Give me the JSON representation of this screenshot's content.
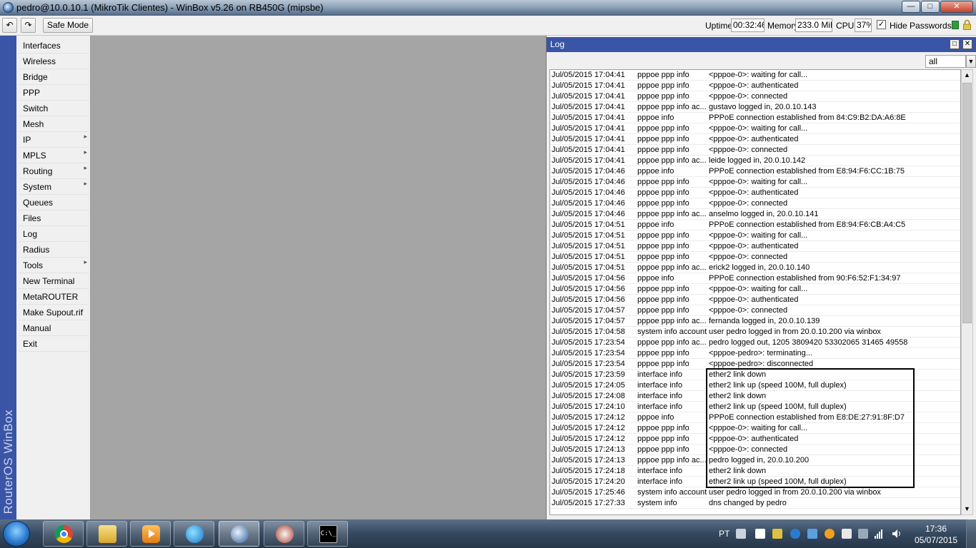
{
  "window": {
    "title": "pedro@10.0.10.1 (MikroTik Clientes) - WinBox v5.26 on RB450G (mipsbe)",
    "minimize_icon": "minimize-icon",
    "maximize_icon": "maximize-icon",
    "close_icon": "close-icon"
  },
  "toolbar": {
    "undo_icon": "undo-icon",
    "redo_icon": "redo-icon",
    "safe_mode_label": "Safe Mode",
    "uptime_label": "Uptime:",
    "uptime_value": "00:32:46",
    "memory_label": "Memory:",
    "memory_value": "233.0 MiB",
    "cpu_label": "CPU:",
    "cpu_value": "37%",
    "hide_passwords_checked": true,
    "hide_passwords_label": "Hide Passwords"
  },
  "sidebar": {
    "brand": "RouterOS WinBox",
    "items": [
      {
        "label": "Interfaces",
        "submenu": false
      },
      {
        "label": "Wireless",
        "submenu": false
      },
      {
        "label": "Bridge",
        "submenu": false
      },
      {
        "label": "PPP",
        "submenu": false
      },
      {
        "label": "Switch",
        "submenu": false
      },
      {
        "label": "Mesh",
        "submenu": false
      },
      {
        "label": "IP",
        "submenu": true
      },
      {
        "label": "MPLS",
        "submenu": true
      },
      {
        "label": "Routing",
        "submenu": true
      },
      {
        "label": "System",
        "submenu": true
      },
      {
        "label": "Queues",
        "submenu": false
      },
      {
        "label": "Files",
        "submenu": false
      },
      {
        "label": "Log",
        "submenu": false
      },
      {
        "label": "Radius",
        "submenu": false
      },
      {
        "label": "Tools",
        "submenu": true
      },
      {
        "label": "New Terminal",
        "submenu": false
      },
      {
        "label": "MetaROUTER",
        "submenu": false
      },
      {
        "label": "Make Supout.rif",
        "submenu": false
      },
      {
        "label": "Manual",
        "submenu": false
      },
      {
        "label": "Exit",
        "submenu": false
      }
    ]
  },
  "log": {
    "title": "Log",
    "filter_value": "all",
    "highlighted_rows": {
      "from": 28,
      "to": 38
    },
    "rows": [
      {
        "time": "Jul/05/2015 17:04:41",
        "topics": "pppoe ppp info",
        "message": "<pppoe-0>: waiting for call..."
      },
      {
        "time": "Jul/05/2015 17:04:41",
        "topics": "pppoe ppp info",
        "message": "<pppoe-0>: authenticated"
      },
      {
        "time": "Jul/05/2015 17:04:41",
        "topics": "pppoe ppp info",
        "message": "<pppoe-0>: connected"
      },
      {
        "time": "Jul/05/2015 17:04:41",
        "topics": "pppoe ppp info ac...",
        "message": "gustavo logged in, 20.0.10.143"
      },
      {
        "time": "Jul/05/2015 17:04:41",
        "topics": "pppoe info",
        "message": "PPPoE connection established from 84:C9:B2:DA:A6:8E"
      },
      {
        "time": "Jul/05/2015 17:04:41",
        "topics": "pppoe ppp info",
        "message": "<pppoe-0>: waiting for call..."
      },
      {
        "time": "Jul/05/2015 17:04:41",
        "topics": "pppoe ppp info",
        "message": "<pppoe-0>: authenticated"
      },
      {
        "time": "Jul/05/2015 17:04:41",
        "topics": "pppoe ppp info",
        "message": "<pppoe-0>: connected"
      },
      {
        "time": "Jul/05/2015 17:04:41",
        "topics": "pppoe ppp info ac...",
        "message": "leide logged in, 20.0.10.142"
      },
      {
        "time": "Jul/05/2015 17:04:46",
        "topics": "pppoe info",
        "message": "PPPoE connection established from E8:94:F6:CC:1B:75"
      },
      {
        "time": "Jul/05/2015 17:04:46",
        "topics": "pppoe ppp info",
        "message": "<pppoe-0>: waiting for call..."
      },
      {
        "time": "Jul/05/2015 17:04:46",
        "topics": "pppoe ppp info",
        "message": "<pppoe-0>: authenticated"
      },
      {
        "time": "Jul/05/2015 17:04:46",
        "topics": "pppoe ppp info",
        "message": "<pppoe-0>: connected"
      },
      {
        "time": "Jul/05/2015 17:04:46",
        "topics": "pppoe ppp info ac...",
        "message": "anselmo logged in, 20.0.10.141"
      },
      {
        "time": "Jul/05/2015 17:04:51",
        "topics": "pppoe info",
        "message": "PPPoE connection established from E8:94:F6:CB:A4:C5"
      },
      {
        "time": "Jul/05/2015 17:04:51",
        "topics": "pppoe ppp info",
        "message": "<pppoe-0>: waiting for call..."
      },
      {
        "time": "Jul/05/2015 17:04:51",
        "topics": "pppoe ppp info",
        "message": "<pppoe-0>: authenticated"
      },
      {
        "time": "Jul/05/2015 17:04:51",
        "topics": "pppoe ppp info",
        "message": "<pppoe-0>: connected"
      },
      {
        "time": "Jul/05/2015 17:04:51",
        "topics": "pppoe ppp info ac...",
        "message": "erick2 logged in, 20.0.10.140"
      },
      {
        "time": "Jul/05/2015 17:04:56",
        "topics": "pppoe info",
        "message": "PPPoE connection established from 90:F6:52:F1:34:97"
      },
      {
        "time": "Jul/05/2015 17:04:56",
        "topics": "pppoe ppp info",
        "message": "<pppoe-0>: waiting for call..."
      },
      {
        "time": "Jul/05/2015 17:04:56",
        "topics": "pppoe ppp info",
        "message": "<pppoe-0>: authenticated"
      },
      {
        "time": "Jul/05/2015 17:04:57",
        "topics": "pppoe ppp info",
        "message": "<pppoe-0>: connected"
      },
      {
        "time": "Jul/05/2015 17:04:57",
        "topics": "pppoe ppp info ac...",
        "message": "fernanda logged in, 20.0.10.139"
      },
      {
        "time": "Jul/05/2015 17:04:58",
        "topics": "system info account",
        "message": "user pedro logged in from 20.0.10.200 via winbox"
      },
      {
        "time": "Jul/05/2015 17:23:54",
        "topics": "pppoe ppp info ac...",
        "message": "pedro logged out, 1205 3809420 53302065 31465 49558"
      },
      {
        "time": "Jul/05/2015 17:23:54",
        "topics": "pppoe ppp info",
        "message": "<pppoe-pedro>: terminating..."
      },
      {
        "time": "Jul/05/2015 17:23:54",
        "topics": "pppoe ppp info",
        "message": "<pppoe-pedro>: disconnected"
      },
      {
        "time": "Jul/05/2015 17:23:59",
        "topics": "interface info",
        "message": "ether2 link down"
      },
      {
        "time": "Jul/05/2015 17:24:05",
        "topics": "interface info",
        "message": "ether2 link up (speed 100M, full duplex)"
      },
      {
        "time": "Jul/05/2015 17:24:08",
        "topics": "interface info",
        "message": "ether2 link down"
      },
      {
        "time": "Jul/05/2015 17:24:10",
        "topics": "interface info",
        "message": "ether2 link up (speed 100M, full duplex)"
      },
      {
        "time": "Jul/05/2015 17:24:12",
        "topics": "pppoe info",
        "message": "PPPoE connection established from E8:DE:27:91:8F:D7"
      },
      {
        "time": "Jul/05/2015 17:24:12",
        "topics": "pppoe ppp info",
        "message": "<pppoe-0>: waiting for call..."
      },
      {
        "time": "Jul/05/2015 17:24:12",
        "topics": "pppoe ppp info",
        "message": "<pppoe-0>: authenticated"
      },
      {
        "time": "Jul/05/2015 17:24:13",
        "topics": "pppoe ppp info",
        "message": "<pppoe-0>: connected"
      },
      {
        "time": "Jul/05/2015 17:24:13",
        "topics": "pppoe ppp info ac...",
        "message": "pedro logged in, 20.0.10.200"
      },
      {
        "time": "Jul/05/2015 17:24:18",
        "topics": "interface info",
        "message": "ether2 link down"
      },
      {
        "time": "Jul/05/2015 17:24:20",
        "topics": "interface info",
        "message": "ether2 link up (speed 100M, full duplex)"
      },
      {
        "time": "Jul/05/2015 17:25:46",
        "topics": "system info account",
        "message": "user pedro logged in from 20.0.10.200 via winbox"
      },
      {
        "time": "Jul/05/2015 17:27:33",
        "topics": "system info",
        "message": "dns changed by pedro"
      }
    ]
  },
  "taskbar": {
    "apps": [
      "chrome-icon",
      "file-explorer-icon",
      "media-player-icon",
      "browser-icon",
      "winbox-icon",
      "app-icon",
      "command-prompt-icon"
    ],
    "language": "PT",
    "time": "17:36",
    "date": "05/07/2015"
  }
}
